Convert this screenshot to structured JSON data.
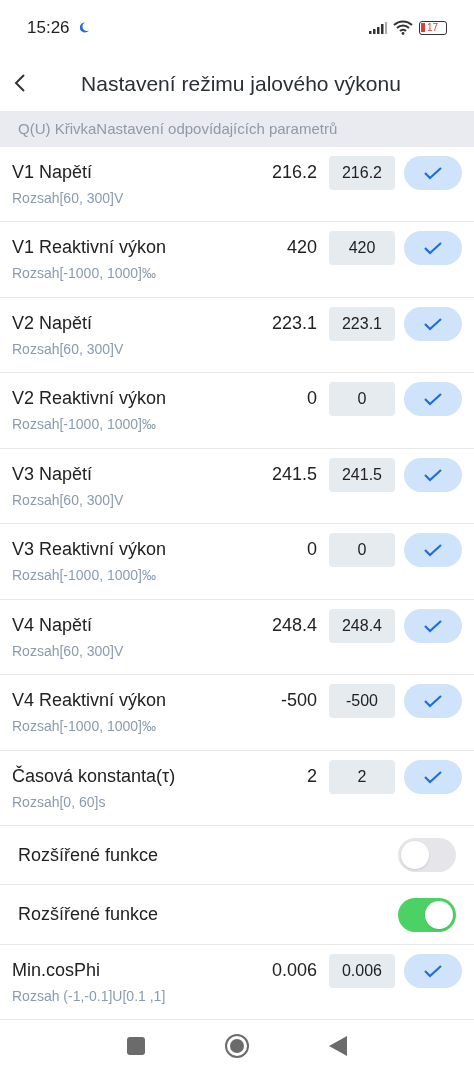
{
  "status_bar": {
    "time": "15:26",
    "battery": "17"
  },
  "header": {
    "title": "Nastavení režimu jalového výkonu"
  },
  "section": {
    "title": "Q(U) KřivkaNastavení odpovídajících parametrů"
  },
  "rows": [
    {
      "kind": "param",
      "label": "V1 Napětí",
      "range": "Rozsah[60, 300]V",
      "current": "216.2",
      "value": "216.2"
    },
    {
      "kind": "param",
      "label": "V1 Reaktivní výkon",
      "range": "Rozsah[-1000, 1000]‰",
      "current": "420",
      "value": "420"
    },
    {
      "kind": "param",
      "label": "V2 Napětí",
      "range": "Rozsah[60, 300]V",
      "current": "223.1",
      "value": "223.1"
    },
    {
      "kind": "param",
      "label": "V2 Reaktivní výkon",
      "range": "Rozsah[-1000, 1000]‰",
      "current": "0",
      "value": "0"
    },
    {
      "kind": "param",
      "label": "V3 Napětí",
      "range": "Rozsah[60, 300]V",
      "current": "241.5",
      "value": "241.5"
    },
    {
      "kind": "param",
      "label": "V3 Reaktivní výkon",
      "range": "Rozsah[-1000, 1000]‰",
      "current": "0",
      "value": "0"
    },
    {
      "kind": "param",
      "label": "V4 Napětí",
      "range": "Rozsah[60, 300]V",
      "current": "248.4",
      "value": "248.4"
    },
    {
      "kind": "param",
      "label": "V4 Reaktivní výkon",
      "range": "Rozsah[-1000, 1000]‰",
      "current": "-500",
      "value": "-500"
    },
    {
      "kind": "param",
      "label": "Časová konstanta(τ)",
      "range": "Rozsah[0, 60]s",
      "current": "2",
      "value": "2"
    },
    {
      "kind": "toggle",
      "label": "Rozšířené funkce",
      "on": false
    },
    {
      "kind": "toggle",
      "label": "Rozšířené funkce",
      "on": true
    },
    {
      "kind": "param",
      "label": "Min.cosPhi",
      "range": "Rozsah (-1,-0.1]U[0.1 ,1]",
      "current": "0.006",
      "value": "0.006"
    }
  ]
}
